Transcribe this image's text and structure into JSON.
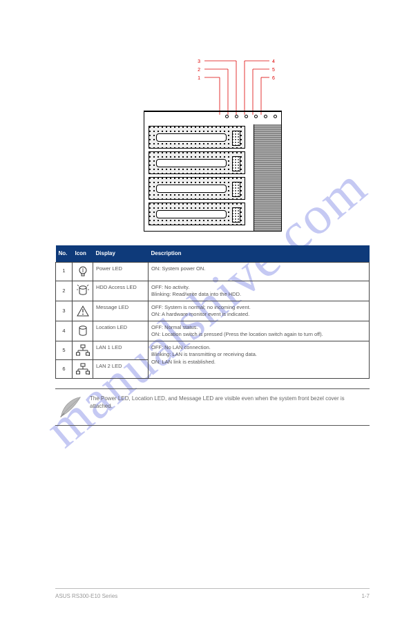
{
  "watermark": "manualshive.com",
  "diagram": {
    "callouts": [
      "1",
      "2",
      "3",
      "4",
      "5",
      "6"
    ]
  },
  "table": {
    "headers": [
      "No.",
      "Icon",
      "Display",
      "Description"
    ],
    "rows": [
      {
        "no": "1",
        "icon": "power-led-icon",
        "display": "Power LED",
        "desc": "ON: System power ON."
      },
      {
        "no": "2",
        "icon": "hdd-access-led-icon",
        "display": "HDD Access LED",
        "desc": "OFF: No activity.\nBlinking: Read/write data into the HDD."
      },
      {
        "no": "3",
        "icon": "warning-icon",
        "display": "Message LED",
        "desc": "OFF: System is normal; no incoming event.\nON: A hardware monitor event is indicated."
      },
      {
        "no": "4",
        "icon": "location-led-icon",
        "display": "Location LED",
        "desc": "OFF: Normal status.\nON: Location switch is pressed (Press the location switch again to turn off)."
      },
      {
        "no": "5",
        "icon": "lan1-icon",
        "display": "LAN 1 LED",
        "desc_merged": "OFF: No LAN connection.\nBlinking: LAN is transmitting or receiving data.\nON: LAN link is established."
      },
      {
        "no": "6",
        "icon": "lan2-icon",
        "display": "LAN 2 LED"
      }
    ]
  },
  "note": "The Power LED, Location LED, and Message LED are visible even when the system front bezel cover is attached.",
  "footer": {
    "left": "ASUS RS300-E10 Series",
    "right": "1-7"
  },
  "icons": {
    "power": "bulb",
    "hdd": "cylinder-sparkle",
    "warn": "triangle-bang",
    "loc": "cylinder",
    "lan1": "network-1",
    "lan2": "network-2"
  }
}
